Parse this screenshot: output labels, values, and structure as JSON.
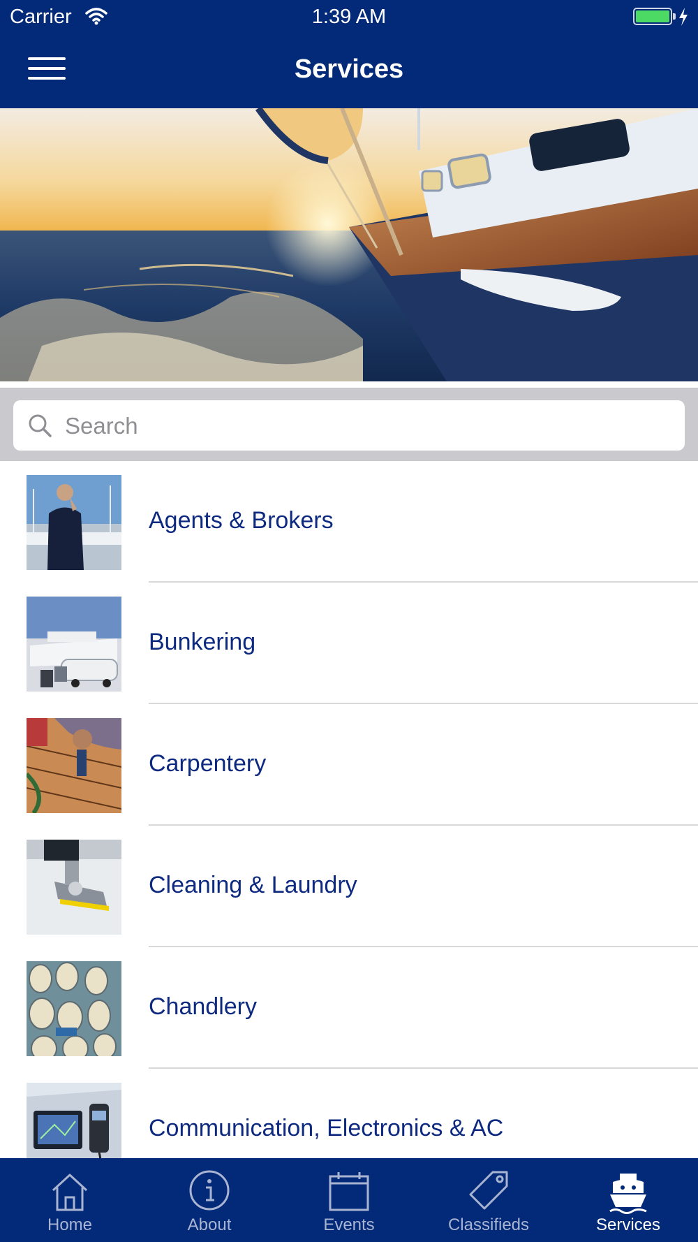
{
  "status_bar": {
    "carrier": "Carrier",
    "time": "1:39 AM",
    "battery_level": 1.0
  },
  "header": {
    "title": "Services",
    "menu_icon": "hamburger-icon"
  },
  "hero": {
    "description_icon": "sailboat-photo"
  },
  "search": {
    "placeholder": "Search",
    "icon": "search-icon"
  },
  "services": [
    {
      "label": "Agents & Brokers",
      "thumb": "agent-photo"
    },
    {
      "label": "Bunkering",
      "thumb": "bunkering-photo"
    },
    {
      "label": "Carpentery",
      "thumb": "carpentry-photo"
    },
    {
      "label": "Cleaning & Laundry",
      "thumb": "cleaning-photo"
    },
    {
      "label": "Chandlery",
      "thumb": "chandlery-photo"
    },
    {
      "label": "Communication, Electronics & AC",
      "thumb": "electronics-photo"
    }
  ],
  "tabbar": {
    "tabs": [
      {
        "label": "Home",
        "icon": "home-icon"
      },
      {
        "label": "About",
        "icon": "info-icon"
      },
      {
        "label": "Events",
        "icon": "calendar-icon"
      },
      {
        "label": "Classifieds",
        "icon": "tag-icon"
      },
      {
        "label": "Services",
        "icon": "boat-icon"
      }
    ],
    "active": "Services"
  },
  "colors": {
    "brand_navy": "#032a78",
    "label_blue": "#0d2a80",
    "battery_green": "#4cd964"
  }
}
